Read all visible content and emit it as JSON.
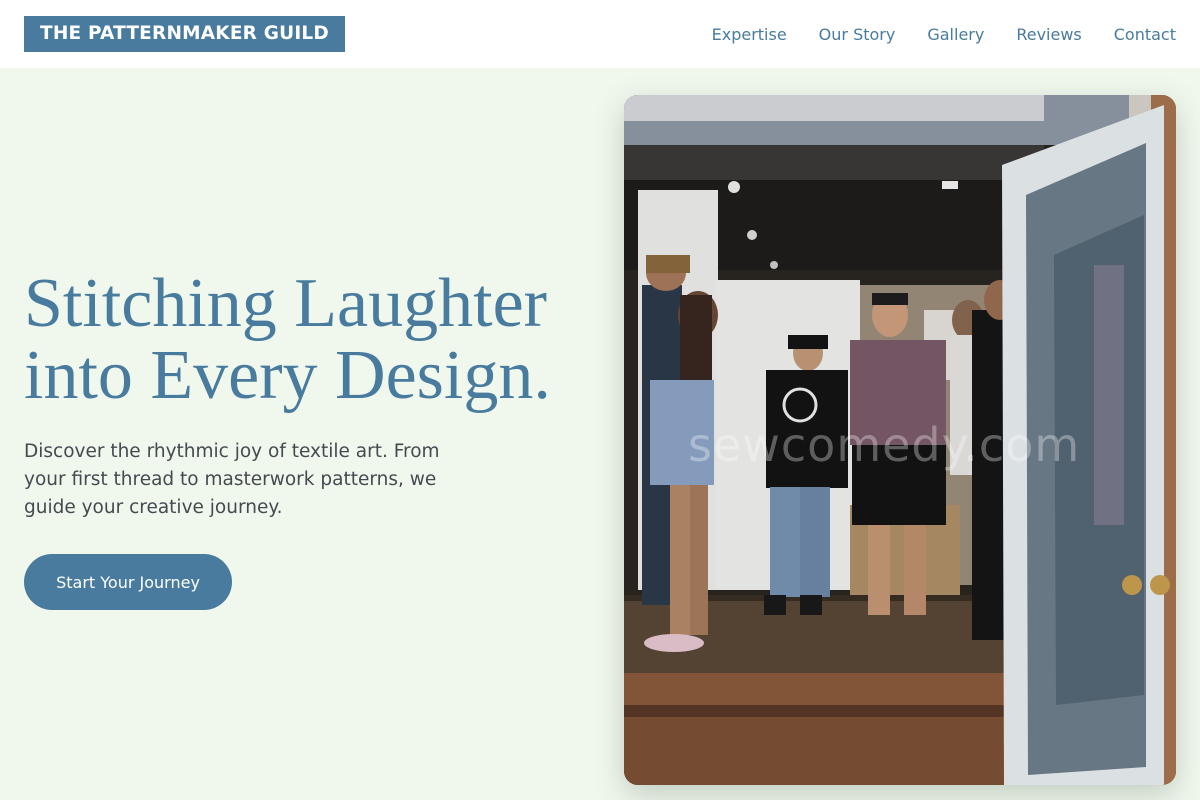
{
  "brand": {
    "logo_text": "THE PATTERNMAKER GUILD"
  },
  "nav": {
    "items": [
      {
        "label": "Expertise"
      },
      {
        "label": "Our Story"
      },
      {
        "label": "Gallery"
      },
      {
        "label": "Reviews"
      },
      {
        "label": "Contact"
      }
    ]
  },
  "hero": {
    "title_line1": "Stitching Laughter",
    "title_line2": "into Every Design.",
    "subtitle": "Discover the rhythmic joy of textile art. From your first thread to masterwork patterns, we guide your creative journey.",
    "cta_label": "Start Your Journey",
    "image_watermark": "sewcomedy.com"
  },
  "colors": {
    "accent": "#487b9d",
    "background": "#f0f8ee",
    "header_bg": "#ffffff",
    "body_text": "#444a50"
  }
}
